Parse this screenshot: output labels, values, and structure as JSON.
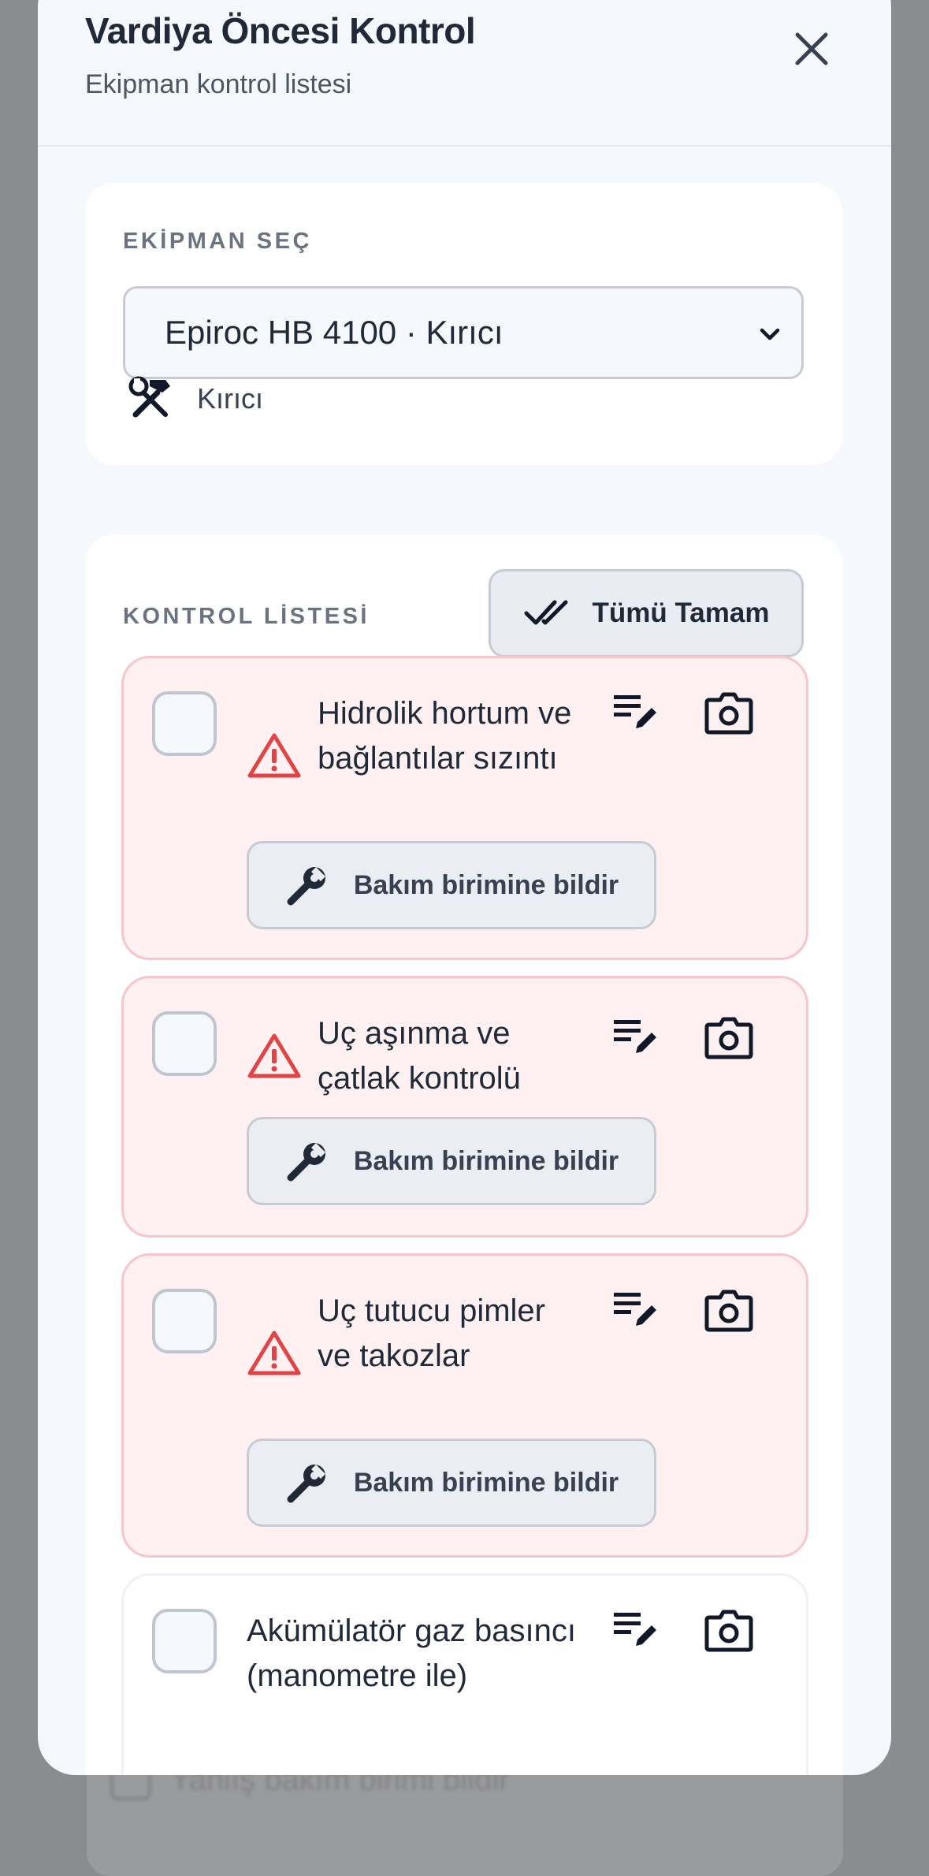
{
  "background_list": {
    "label": "Yanlış bakım birimi bildir"
  },
  "modal": {
    "title": "Vardiya Öncesi Kontrol",
    "subtitle": "Ekipman kontrol listesi"
  },
  "equipment": {
    "section_label": "EKİPMAN SEÇ",
    "selected": "Epiroc HB 4100 · Kırıcı",
    "type": "Kırıcı"
  },
  "checklist": {
    "section_label": "KONTROL LİSTESİ",
    "all_ok_label": "Tümü Tamam",
    "report_label": "Bakım birimine bildir",
    "items": [
      {
        "label": "Hidrolik hortum ve bağlantılar sızıntı",
        "status": "warning"
      },
      {
        "label": "Uç aşınma ve çatlak kontrolü",
        "status": "warning"
      },
      {
        "label": "Uç tutucu pimler ve takozlar",
        "status": "warning"
      },
      {
        "label": "Akümülatör gaz basıncı (manometre ile)",
        "status": "unchecked"
      }
    ]
  },
  "colors": {
    "accent_warning": "#e04444",
    "item_warning_bg": "#fff1f2",
    "item_warning_border": "#f6c6cb"
  }
}
